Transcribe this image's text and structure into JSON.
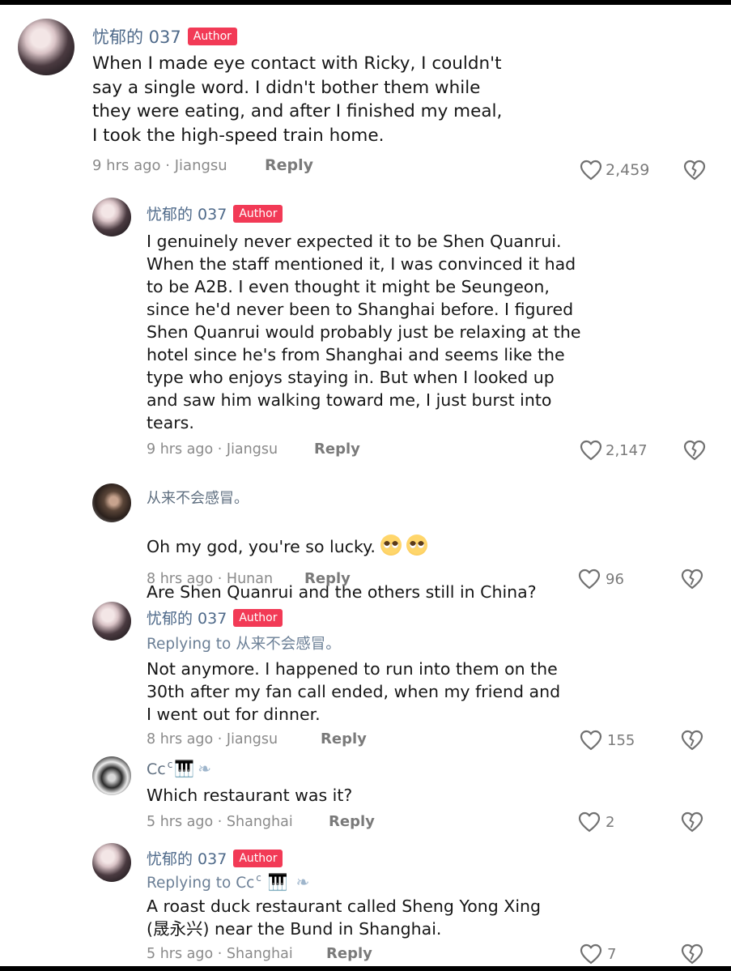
{
  "comments": [
    {
      "username": "忧郁的 037",
      "badge": "Author",
      "text": "When I made eye contact with Ricky, I couldn't\nsay a single word. I didn't bother them while\nthey were eating, and after I finished my meal,\nI took the high-speed train home.",
      "time": "9 hrs ago",
      "location": "Jiangsu",
      "reply": "Reply",
      "likes": "2,459"
    },
    {
      "username": "忧郁的 037",
      "badge": "Author",
      "text": "I genuinely never expected it to be Shen Quanrui.\nWhen the staff mentioned it, I was convinced it had\nto be A2B. I even thought it might be Seungeon,\nsince he'd never been to Shanghai before. I figured\nShen Quanrui would probably just be relaxing at the\nhotel since he's from Shanghai and seems like the\ntype who enjoys staying in. But when I looked up\nand saw him walking toward me, I just burst into\ntears.",
      "time": "9 hrs ago",
      "location": "Jiangsu",
      "reply": "Reply",
      "likes": "2,147"
    },
    {
      "username": "从来不会感冒。",
      "text_line1": "Oh my god, you're so lucky.",
      "text_line2": "Are Shen Quanrui and the others still in China?",
      "time": "8 hrs ago",
      "location": "Hunan",
      "reply": "Reply",
      "likes": "96"
    },
    {
      "username": "忧郁的 037",
      "badge": "Author",
      "replying_prefix": "Replying to ",
      "replying_to": "从来不会感冒。",
      "text": "Not anymore. I happened to run into them on the\n30th after my fan call ended, when my friend and\nI went out for dinner.",
      "time": "8 hrs ago",
      "location": "Jiangsu",
      "reply": "Reply",
      "likes": "155"
    },
    {
      "username": "Cc",
      "username_sup": "c",
      "text": "Which restaurant was it?",
      "time": "5 hrs ago",
      "location": "Shanghai",
      "reply": "Reply",
      "likes": "2"
    },
    {
      "username": "忧郁的 037",
      "badge": "Author",
      "replying_prefix": "Replying to ",
      "replying_to": "Cc",
      "replying_sup": "c",
      "text": "A roast duck restaurant called Sheng Yong Xing\n(晟永兴) near the Bund in Shanghai.",
      "time": "5 hrs ago",
      "location": "Shanghai",
      "reply": "Reply",
      "likes": "7"
    }
  ],
  "separator": " · ",
  "icons": {
    "like": "heart-outline-icon",
    "dislike": "broken-heart-icon",
    "emoji": "pleading-face-emoji",
    "piano": "piano-emoji",
    "wing": "wing-emoji"
  },
  "colors": {
    "badge": "#f23a56",
    "username": "#4f6a8a",
    "meta": "#8a8a8a"
  }
}
